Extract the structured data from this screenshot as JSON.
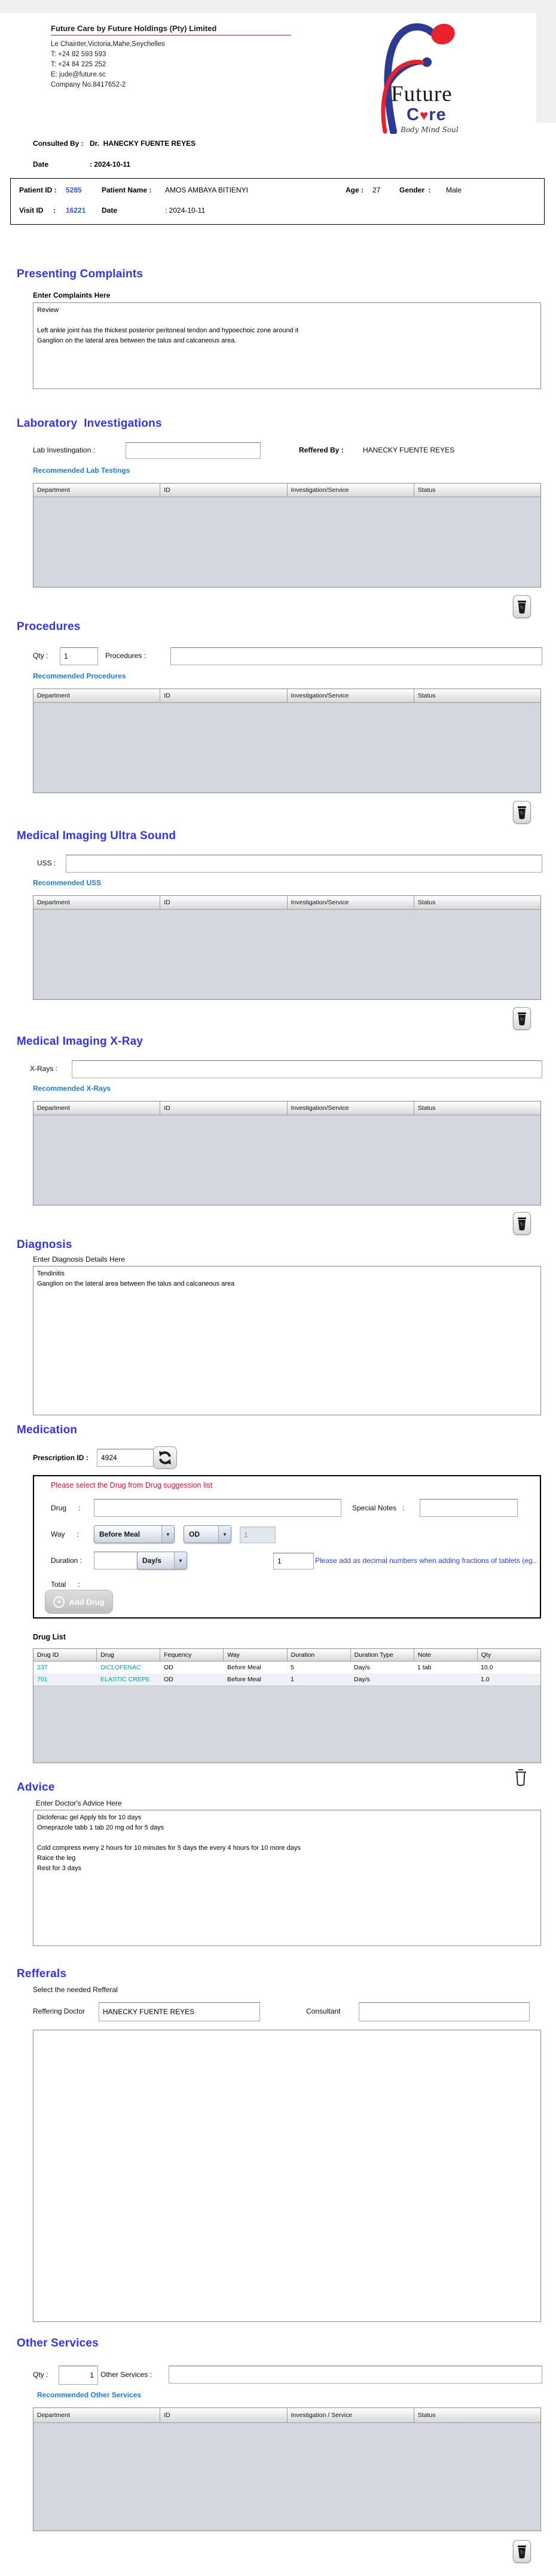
{
  "icons": {
    "dropdown_arrow": "▼",
    "add_plus": "+",
    "heart": "♥"
  },
  "colors": {
    "heading_blue": "#3433ef",
    "link_blue": "#1b7ce4",
    "warning_red": "#d6164b",
    "teal_drug": "#00a0a6",
    "id_blue": "#2a5bd7",
    "logo_blue": "#2b3a92",
    "logo_red": "#e8212e"
  },
  "company": {
    "name": "Future Care by Future Holdings (Pty) Limited",
    "address": "Le Chainter,Victoria,Mahe,Seychelles",
    "phone1": "T: +24  82 593 593",
    "phone2": "T: +24  84 225 252",
    "email": "E: jude@future.sc",
    "company_no": "Company No.8417652-2",
    "logo": {
      "word1": "Future",
      "word2_c": "C",
      "word2_rest": "re",
      "tagline": "Body Mind Soul"
    }
  },
  "consult": {
    "label": "Consulted By :",
    "value": "Dr.  HANECKY FUENTE REYES",
    "date_label": "Date",
    "date_value": ": 2024-10-11"
  },
  "patient": {
    "id_label": "Patient ID :",
    "id": "5285",
    "name_label": "Patient Name :",
    "name": "AMOS AMBAYA BITIENYI",
    "age_label": "Age :",
    "age": "27",
    "gender_label": "Gender  :",
    "gender": "Male",
    "visit_label": "Visit ID     :",
    "visit_id": "16221",
    "date_label": "Date",
    "date_value": ": 2024-10-11"
  },
  "complaints": {
    "title": "Presenting Complaints",
    "label": "Enter Complaints Here",
    "text": "Review\n\nLeft ankle joint has the thickest posterior peritoneal tendon and hypoechoic zone around it\nGanglion on the lateral area between the talus and calcaneous area."
  },
  "lab": {
    "title": "Laboratory  Investigations",
    "input_label": "Lab Investingation :",
    "referred_label": "Reffered By :",
    "referred_value": "HANECKY FUENTE REYES",
    "recommended": "Recommended Lab Testings",
    "headers": [
      "Department",
      "ID",
      "Investigation/Service",
      "Status"
    ]
  },
  "procedures": {
    "title": "Procedures",
    "qty_label": "Qty :",
    "qty": "1",
    "input_label": "Procedures :",
    "recommended": "Recommended Procedures",
    "headers": [
      "Department",
      "ID",
      "Investigation/Service",
      "Status"
    ]
  },
  "uss": {
    "title": "Medical Imaging Ultra Sound",
    "input_label": "USS :",
    "recommended": "Recommended USS",
    "headers": [
      "Department",
      "ID",
      "Investigation/Service",
      "Status"
    ]
  },
  "xray": {
    "title": "Medical Imaging X-Ray",
    "input_label": "X-Rays :",
    "recommended": "Recommended X-Rays",
    "headers": [
      "Department",
      "ID",
      "Investigation/Service",
      "Status"
    ]
  },
  "diagnosis": {
    "title": "Diagnosis",
    "label": "Enter Diagnosis Details Here",
    "text": "Tendinitis\nGanglion on the lateral area between the talus and calcaneous area"
  },
  "medication": {
    "title": "Medication",
    "prescription_label": "Prescription ID :",
    "prescription_id": "4924",
    "warning": "Please select the Drug from Drug suggession list",
    "drug_label": "Drug      :",
    "special_notes_label": "Special Notes   :",
    "way_label": "Way      :",
    "way_select": "Before Meal",
    "freq_select": "OD",
    "dose_value": "1",
    "duration_label": "Duration :",
    "duration_type_select": "Day/s",
    "qty_value": "1",
    "fraction_note": "Please add as decimal numbers when adding fractions of tablets (eg...",
    "total_label": "Total      :",
    "add_drug_label": "Add Drug",
    "drug_list_label": "Drug List",
    "drug_headers": [
      "Drug ID",
      "Drug",
      "Fequency",
      "Way",
      "Duration",
      "Duration Type",
      "Note",
      "Qty"
    ],
    "rows": [
      {
        "drug_id": "237",
        "drug": "DICLOFENAC",
        "frequency": "OD",
        "way": "Before Meal",
        "duration": "5",
        "duration_type": "Day/s",
        "note": "1 tab",
        "qty": "10.0"
      },
      {
        "drug_id": "701",
        "drug": "ELASTIC CREPE",
        "frequency": "OD",
        "way": "Before Meal",
        "duration": "1",
        "duration_type": "Day/s",
        "note": "",
        "qty": "1.0"
      }
    ]
  },
  "advice": {
    "title": "Advice",
    "label": "Enter Doctor's Advice Here",
    "text": "Diclofenac gel Apply tds for 10 days\nOmeprazole tabb 1 tab 20 mg od for 5 days\n\nCold compress every 2 hours for 10 minutes for 5 days the every 4 hours for 10 more days\nRaice the leg\nRest for 3 days"
  },
  "refferals": {
    "title": "Refferals",
    "label": "Select the needed Refferal",
    "doctor_label": "Reffering Doctor",
    "doctor_value": "HANECKY FUENTE REYES",
    "consultant_label": "Consultant"
  },
  "other_services": {
    "title": "Other Services",
    "qty_label": "Qty :",
    "qty": "1",
    "input_label": "Other Services :",
    "recommended": "Recommended Other Services",
    "headers": [
      "Department",
      "ID",
      "Investigation / Service",
      "Status"
    ]
  }
}
